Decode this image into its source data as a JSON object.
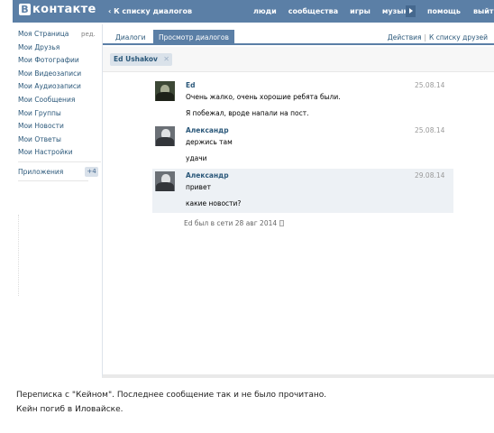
{
  "header": {
    "logo_mark": "В",
    "logo_text": "контакте",
    "back_link": "К списку диалогов",
    "nav": [
      "люди",
      "сообщества",
      "игры",
      "музыка"
    ],
    "nav_right": [
      "помощь",
      "выйти"
    ]
  },
  "sidebar": {
    "edit_label": "ред.",
    "items": [
      "Моя Страница",
      "Мои Друзья",
      "Мои Фотографии",
      "Мои Видеозаписи",
      "Мои Аудиозаписи",
      "Мои Сообщения",
      "Мои Группы",
      "Мои Новости",
      "Мои Ответы",
      "Мои Настройки"
    ],
    "apps_label": "Приложения",
    "apps_badge": "+4"
  },
  "tabs": {
    "dialogs": "Диалоги",
    "view": "Просмотр диалогов",
    "actions": "Действия",
    "back_to_friends": "К списку друзей",
    "separator": "|"
  },
  "filter": {
    "chip_label": "Ed Ushakov",
    "chip_close": "✕"
  },
  "messages": [
    {
      "author": "Ed",
      "date": "25.08.14",
      "lines": [
        "Очень жалко, очень хорошие ребята были.",
        "Я побежал, вроде напали на пост."
      ]
    },
    {
      "author": "Александр",
      "date": "25.08.14",
      "lines": [
        "держись там",
        "удачи"
      ]
    },
    {
      "author": "Александр",
      "date": "29.08.14",
      "lines": [
        "привет",
        "какие новости?"
      ]
    }
  ],
  "status": "Ed был в сети 28 авг 2014",
  "caption": {
    "line1": "Переписка с \"Кейном\". Последнее сообщение так и не было прочитано.",
    "line2": "Кейн погиб в Иловайске."
  }
}
